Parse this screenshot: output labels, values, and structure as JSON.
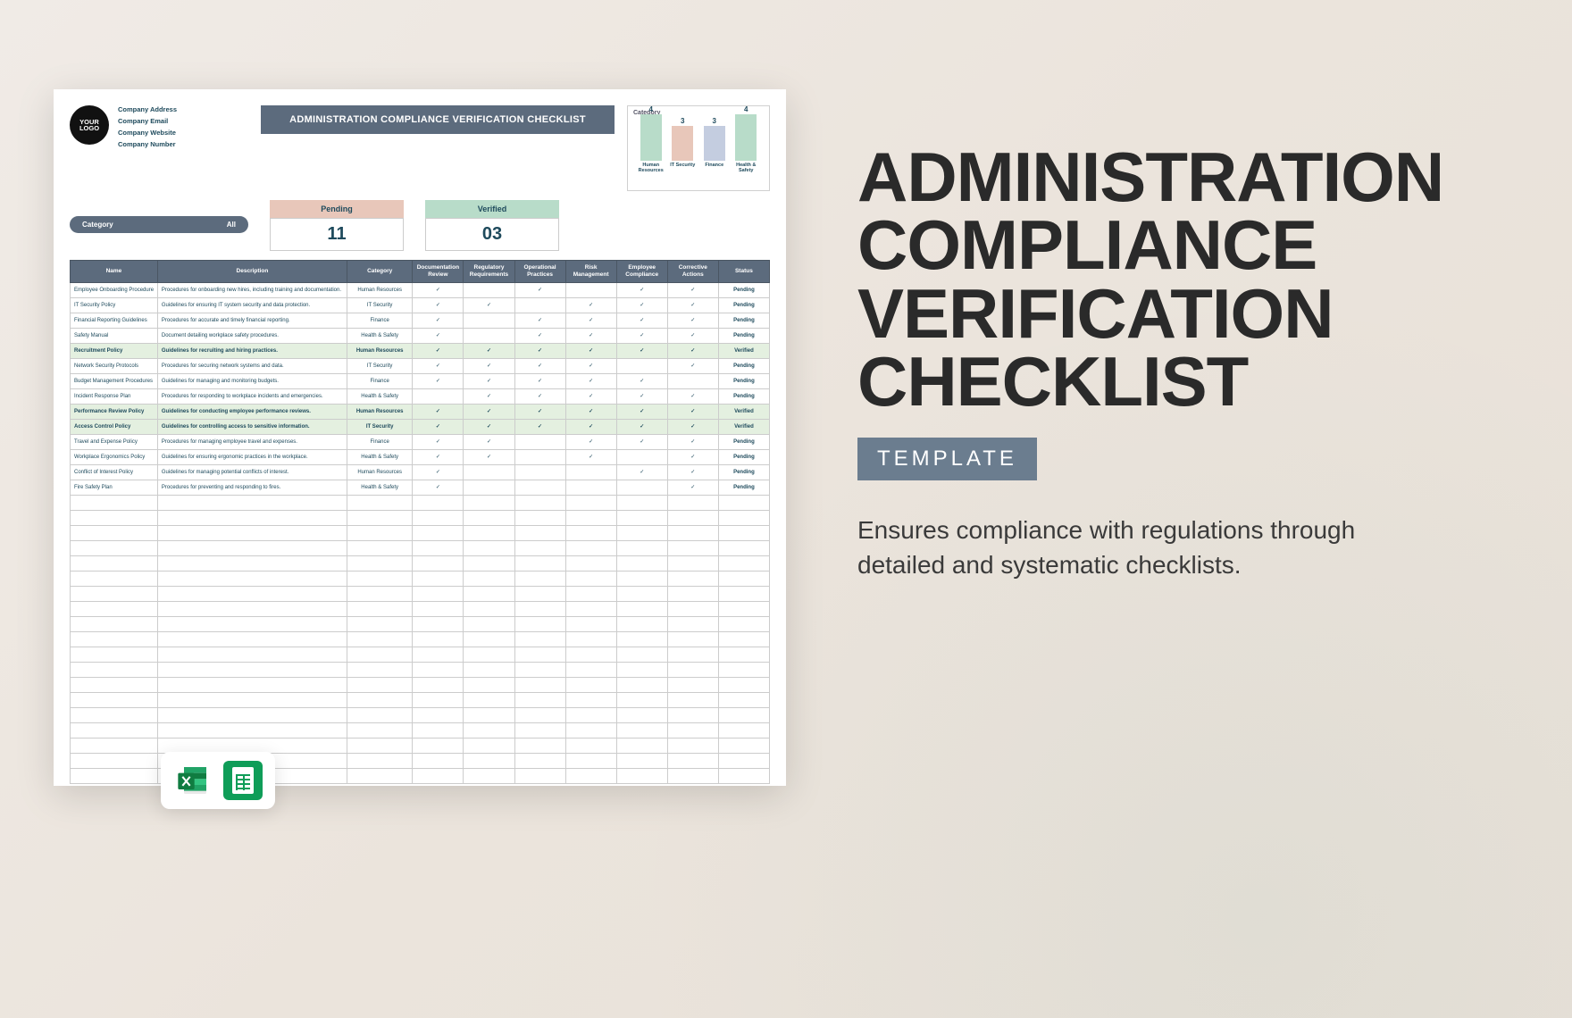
{
  "logo_text": "YOUR\nLOGO",
  "company": {
    "address": "Company Address",
    "email": "Company Email",
    "website": "Company Website",
    "number": "Company Number"
  },
  "title": "ADMINISTRATION COMPLIANCE VERIFICATION CHECKLIST",
  "filter": {
    "label": "Category",
    "value": "All"
  },
  "stats": {
    "pending_label": "Pending",
    "pending_value": "11",
    "verified_label": "Verified",
    "verified_value": "03"
  },
  "chart_data": {
    "type": "bar",
    "title": "Category",
    "categories": [
      "Human Resources",
      "IT Security",
      "Finance",
      "Health & Safety"
    ],
    "values": [
      4,
      3,
      3,
      4
    ],
    "colors": [
      "#b8dcc9",
      "#e8c7ba",
      "#c4cde0",
      "#b8dcc9"
    ],
    "ylim": [
      0,
      4
    ]
  },
  "columns": [
    "Name",
    "Description",
    "Category",
    "Documentation Review",
    "Regulatory Requirements",
    "Operational Practices",
    "Risk Management",
    "Employee Compliance",
    "Corrective Actions",
    "Status"
  ],
  "rows": [
    {
      "name": "Employee Onboarding Procedure",
      "desc": "Procedures for onboarding new hires, including training and documentation.",
      "cat": "Human Resources",
      "c": [
        1,
        0,
        1,
        0,
        1,
        1
      ],
      "status": "Pending",
      "v": false
    },
    {
      "name": "IT Security Policy",
      "desc": "Guidelines for ensuring IT system security and data protection.",
      "cat": "IT Security",
      "c": [
        1,
        1,
        0,
        1,
        1,
        1
      ],
      "status": "Pending",
      "v": false
    },
    {
      "name": "Financial Reporting Guidelines",
      "desc": "Procedures for accurate and timely financial reporting.",
      "cat": "Finance",
      "c": [
        1,
        0,
        1,
        1,
        1,
        1
      ],
      "status": "Pending",
      "v": false
    },
    {
      "name": "Safety Manual",
      "desc": "Document detailing workplace safety procedures.",
      "cat": "Health & Safety",
      "c": [
        1,
        0,
        1,
        1,
        1,
        1
      ],
      "status": "Pending",
      "v": false
    },
    {
      "name": "Recruitment Policy",
      "desc": "Guidelines for recruiting and hiring practices.",
      "cat": "Human Resources",
      "c": [
        1,
        1,
        1,
        1,
        1,
        1
      ],
      "status": "Verified",
      "v": true
    },
    {
      "name": "Network Security Protocols",
      "desc": "Procedures for securing network systems and data.",
      "cat": "IT Security",
      "c": [
        1,
        1,
        1,
        1,
        0,
        1
      ],
      "status": "Pending",
      "v": false
    },
    {
      "name": "Budget Management Procedures",
      "desc": "Guidelines for managing and monitoring budgets.",
      "cat": "Finance",
      "c": [
        1,
        1,
        1,
        1,
        1,
        0
      ],
      "status": "Pending",
      "v": false
    },
    {
      "name": "Incident Response Plan",
      "desc": "Procedures for responding to workplace incidents and emergencies.",
      "cat": "Health & Safety",
      "c": [
        0,
        1,
        1,
        1,
        1,
        1
      ],
      "status": "Pending",
      "v": false
    },
    {
      "name": "Performance Review Policy",
      "desc": "Guidelines for conducting employee performance reviews.",
      "cat": "Human Resources",
      "c": [
        1,
        1,
        1,
        1,
        1,
        1
      ],
      "status": "Verified",
      "v": true
    },
    {
      "name": "Access Control Policy",
      "desc": "Guidelines for controlling access to sensitive information.",
      "cat": "IT Security",
      "c": [
        1,
        1,
        1,
        1,
        1,
        1
      ],
      "status": "Verified",
      "v": true
    },
    {
      "name": "Travel and Expense Policy",
      "desc": "Procedures for managing employee travel and expenses.",
      "cat": "Finance",
      "c": [
        1,
        1,
        0,
        1,
        1,
        1
      ],
      "status": "Pending",
      "v": false
    },
    {
      "name": "Workplace Ergonomics Policy",
      "desc": "Guidelines for ensuring ergonomic practices in the workplace.",
      "cat": "Health & Safety",
      "c": [
        1,
        1,
        0,
        1,
        0,
        1
      ],
      "status": "Pending",
      "v": false
    },
    {
      "name": "Conflict of Interest Policy",
      "desc": "Guidelines for managing potential conflicts of interest.",
      "cat": "Human Resources",
      "c": [
        1,
        0,
        0,
        0,
        1,
        1
      ],
      "status": "Pending",
      "v": false
    },
    {
      "name": "Fire Safety Plan",
      "desc": "Procedures for preventing and responding to fires.",
      "cat": "Health & Safety",
      "c": [
        1,
        0,
        0,
        0,
        0,
        1
      ],
      "status": "Pending",
      "v": false
    }
  ],
  "empty_rows": 19,
  "hero": {
    "title": "ADMINISTRATION COMPLIANCE VERIFICATION CHECKLIST",
    "badge": "TEMPLATE",
    "desc": "Ensures compliance with regulations through detailed and systematic checklists."
  },
  "icons": {
    "excel": "excel-icon",
    "gsheet": "google-sheets-icon"
  }
}
